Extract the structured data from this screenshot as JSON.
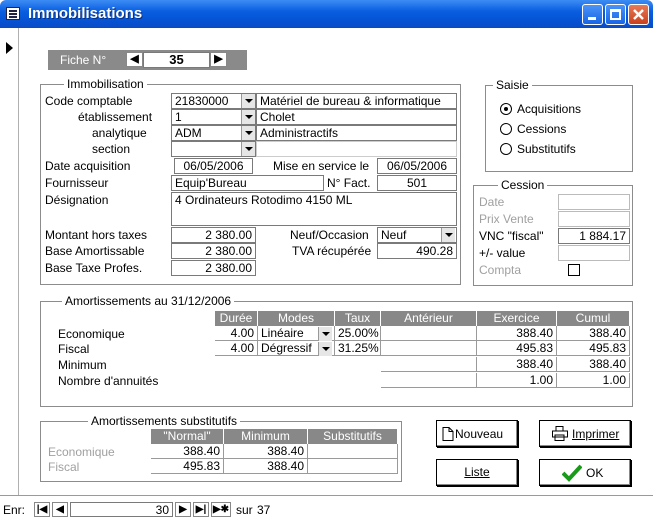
{
  "window": {
    "title": "Immobilisations"
  },
  "fiche": {
    "label": "Fiche N°",
    "number": "35"
  },
  "immobilisation": {
    "legend": "Immobilisation",
    "code_label": "Code comptable",
    "code_value": "21830000",
    "code_desc": "Matériel de bureau & informatique",
    "etab_label": "établissement",
    "etab_value": "1",
    "etab_desc": "Cholet",
    "analytique_label": "analytique",
    "analytique_value": "ADM",
    "analytique_desc": "Administractifs",
    "section_label": "section",
    "section_value": "",
    "date_acq_label": "Date acquisition",
    "date_acq_value": "06/05/2006",
    "mise_service_label": "Mise en service le",
    "mise_service_value": "06/05/2006",
    "fournisseur_label": "Fournisseur",
    "fournisseur_value": "Equip'Bureau",
    "nfact_label": "N° Fact.",
    "nfact_value": "501",
    "designation_label": "Désignation",
    "designation_value": "4 Ordinateurs Rotodimo 4150 ML",
    "montant_label": "Montant hors taxes",
    "montant_value": "2 380.00",
    "neuf_label": "Neuf/Occasion",
    "neuf_value": "Neuf",
    "base_amort_label": "Base Amortissable",
    "base_amort_value": "2 380.00",
    "tva_label": "TVA récupérée",
    "tva_value": "490.28",
    "base_taxe_label": "Base Taxe Profes.",
    "base_taxe_value": "2 380.00"
  },
  "saisie": {
    "legend": "Saisie",
    "options": [
      {
        "label": "Acquisitions",
        "selected": true
      },
      {
        "label": "Cessions",
        "selected": false
      },
      {
        "label": "Substitutifs",
        "selected": false
      }
    ]
  },
  "cession": {
    "legend": "Cession",
    "date_label": "Date",
    "prix_label": "Prix Vente",
    "vnc_label": "VNC \"fiscal\"",
    "vnc_value": "1 884.17",
    "plus_value_label": "+/- value",
    "compta_label": "Compta"
  },
  "amortissements": {
    "legend": "Amortissements au 31/12/2006",
    "headers": [
      "Durée",
      "Modes",
      "Taux",
      "Antérieur",
      "Exercice",
      "Cumul"
    ],
    "rows": [
      {
        "label": "Economique",
        "duree": "4.00",
        "mode": "Linéaire",
        "taux": "25.00%",
        "anterieur": "",
        "exercice": "388.40",
        "cumul": "388.40"
      },
      {
        "label": "Fiscal",
        "duree": "4.00",
        "mode": "Dégressif",
        "taux": "31.25%",
        "anterieur": "",
        "exercice": "495.83",
        "cumul": "495.83"
      },
      {
        "label": "Minimum",
        "anterieur": "",
        "exercice": "388.40",
        "cumul": "388.40"
      },
      {
        "label": "Nombre d'annuités",
        "anterieur": "",
        "exercice": "1.00",
        "cumul": "1.00"
      }
    ]
  },
  "substitutifs": {
    "legend": "Amortissements substitutifs",
    "headers": [
      "\"Normal\"",
      "Minimum",
      "Substitutifs"
    ],
    "rows": [
      {
        "label": "Economique",
        "normal": "388.40",
        "minimum": "388.40",
        "substitutifs": ""
      },
      {
        "label": "Fiscal",
        "normal": "495.83",
        "minimum": "388.40",
        "substitutifs": ""
      }
    ]
  },
  "buttons": {
    "nouveau": "Nouveau",
    "imprimer": "Imprimer",
    "liste": "Liste",
    "ok": "OK"
  },
  "record_nav": {
    "label": "Enr:",
    "current": "30",
    "total_label": "sur",
    "total": "37"
  }
}
